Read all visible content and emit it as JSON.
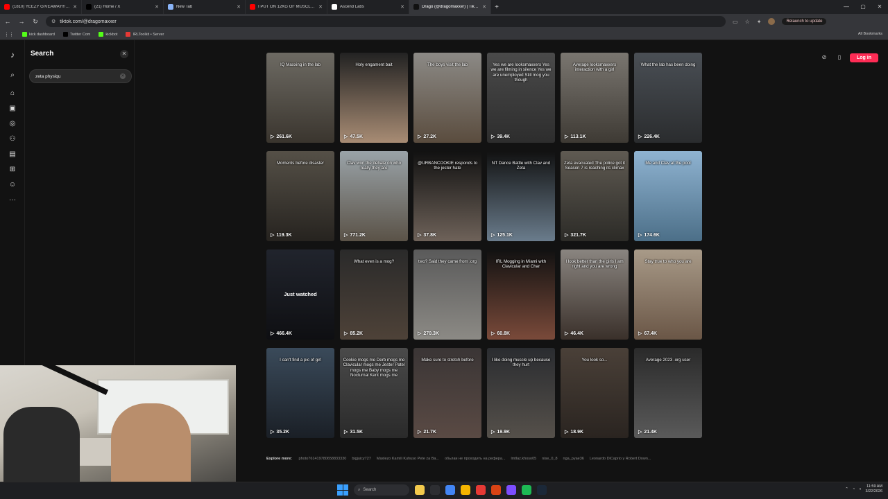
{
  "browser": {
    "tabs": [
      {
        "label": "(1810) YEEZY GIVEAWAY!!! | 67",
        "favicon_color": "#ff0000",
        "active": false
      },
      {
        "label": "(21) Home / X",
        "favicon_color": "#000000",
        "active": false
      },
      {
        "label": "New Tab",
        "favicon_color": "#8ab4f8",
        "active": false
      },
      {
        "label": "I PUT ON 12KG OF MUSCLE IN",
        "favicon_color": "#ff0000",
        "active": false
      },
      {
        "label": "Ascend Labs",
        "favicon_color": "#ffffff",
        "active": false
      },
      {
        "label": "Drago (@dragomaxxer) | TikTok",
        "favicon_color": "#111111",
        "active": true
      }
    ],
    "url": "tiktok.com/@dragomaxxer",
    "relaunch_label": "Relaunch to update",
    "bookmarks": [
      {
        "label": "kick dashboard",
        "color": "#53fc18"
      },
      {
        "label": "Twitter Com",
        "color": "#000000"
      },
      {
        "label": "kickbot",
        "color": "#53fc18"
      },
      {
        "label": "IRLToolkit • Server",
        "color": "#e53935"
      }
    ],
    "all_bookmarks_label": "All Bookmarks"
  },
  "sidebar": {
    "title": "Search",
    "search_value": "zeta physiqu",
    "rail_icons": [
      "tiktok-logo-icon",
      "search-icon",
      "home-icon",
      "shop-icon",
      "explore-icon",
      "following-icon",
      "live-icon",
      "upload-icon",
      "profile-icon",
      "more-icon"
    ]
  },
  "header": {
    "login_label": "Log in"
  },
  "videos": [
    {
      "caption": "IQ Maxxing in the lab",
      "views": "261.6K",
      "bg": "linear-gradient(180deg,#6d6a63,#3a352e)"
    },
    {
      "caption": "Holy engament bait",
      "views": "47.5K",
      "bg": "linear-gradient(180deg,#222,#a88c74)"
    },
    {
      "caption": "The boys visit the lab",
      "views": "27.2K",
      "bg": "linear-gradient(180deg,#8c8a86,#5a4c3e)"
    },
    {
      "caption": "Yes we are looksmaxxers Yes we are filming in silence Yes we are unemployed Still mog you though",
      "views": "39.4K",
      "bg": "linear-gradient(180deg,#4a4a4a,#2d2d2d)"
    },
    {
      "caption": "Average looksmaxxers interaction with a girl",
      "views": "113.1K",
      "bg": "linear-gradient(180deg,#7a7670,#3e3a34)"
    },
    {
      "caption": "What the lab has been doing",
      "views": "226.4K",
      "bg": "linear-gradient(180deg,#4a4f55,#2a2c2e)"
    },
    {
      "caption": "Moments before disaster",
      "views": "119.3K",
      "bg": "linear-gradient(180deg,#555047,#26231f)"
    },
    {
      "caption": "Clav won the debate on who really they are",
      "views": "771.2K",
      "bg": "linear-gradient(180deg,#9aa3a8,#5a5247)"
    },
    {
      "caption": "@URBANCOOKIE responds to the jester hate",
      "views": "37.8K",
      "bg": "linear-gradient(180deg,#111,#6e6259)"
    },
    {
      "caption": "NT Dance Battle with Clav and Zeta",
      "views": "125.1K",
      "bg": "linear-gradient(180deg,#111,#6a7c8c)"
    },
    {
      "caption": "Zeta evacuated The police got it Season 7 is reaching its climax",
      "views": "321.7K",
      "bg": "linear-gradient(180deg,#5f5a52,#2c2b27)"
    },
    {
      "caption": "Me and Clav at the pool",
      "views": "174.6K",
      "bg": "linear-gradient(180deg,#8fb3d1,#4c6f88)"
    },
    {
      "caption": "",
      "views": "466.4K",
      "bg": "linear-gradient(180deg,#3c4252,#1b1c22)",
      "watched": "Just watched"
    },
    {
      "caption": "What even is a mog?",
      "views": "85.2K",
      "bg": "linear-gradient(180deg,#2a2a2a,#4e4238)"
    },
    {
      "caption": "two? Said they came from .org",
      "views": "270.3K",
      "bg": "linear-gradient(180deg,#5a5a5a,#8c8a85)"
    },
    {
      "caption": "IRL Mogging in Miami with Clavicular and Char",
      "views": "60.8K",
      "bg": "linear-gradient(180deg,#111,#7a4a3a)"
    },
    {
      "caption": "I look better than the girls I am right and you are wrong",
      "views": "46.4K",
      "bg": "linear-gradient(180deg,#8a8580,#3a302a)"
    },
    {
      "caption": "Stay true to who you are",
      "views": "67.4K",
      "bg": "linear-gradient(180deg,#a89a88,#6a5646)"
    },
    {
      "caption": "I can't find a pic of girl",
      "views": "35.2K",
      "bg": "linear-gradient(180deg,#3a4a5a,#1a1f26)"
    },
    {
      "caption": "Cookie mogs me Derb mogs me Clavicular mogs me Jester Patel mogs me Baby mogs me Nocturnal Kent mogs me",
      "views": "31.5K",
      "bg": "linear-gradient(180deg,#4a4a4a,#2a2a2a)"
    },
    {
      "caption": "Make sure to stretch before",
      "views": "21.7K",
      "bg": "linear-gradient(180deg,#3a3535,#5a4a44)"
    },
    {
      "caption": "I like doing muscle up because they hurt",
      "views": "19.9K",
      "bg": "linear-gradient(180deg,#2a2c30,#55504a)"
    },
    {
      "caption": "You look so...",
      "views": "18.9K",
      "bg": "linear-gradient(180deg,#4a4038,#2a2420)"
    },
    {
      "caption": "Average 2023 .org user",
      "views": "21.4K",
      "bg": "linear-gradient(180deg,#2a2a2a,#5a5a5a)"
    }
  ],
  "explore_more": {
    "label": "Explore more:",
    "links": [
      "photo761419780658833330",
      "bigjuicy727",
      "Maxlezo Kamili Kuhuso Pete za Ba...",
      "обьлаи не проходить на рефера...",
      "lmtlaz.khoso05",
      "nise_0_8",
      "nga_pyae36",
      "Leonardo DiCaprio y Robert Down..."
    ]
  },
  "taskbar": {
    "search_placeholder": "Search",
    "time": "11:59 AM",
    "date": "3/22/2026",
    "app_colors": [
      "#f2c94c",
      "#2d2e32",
      "#4285f4",
      "#f4b400",
      "#e53935",
      "#d84315",
      "#7c4dff",
      "#1db954",
      "#1b2838"
    ]
  }
}
